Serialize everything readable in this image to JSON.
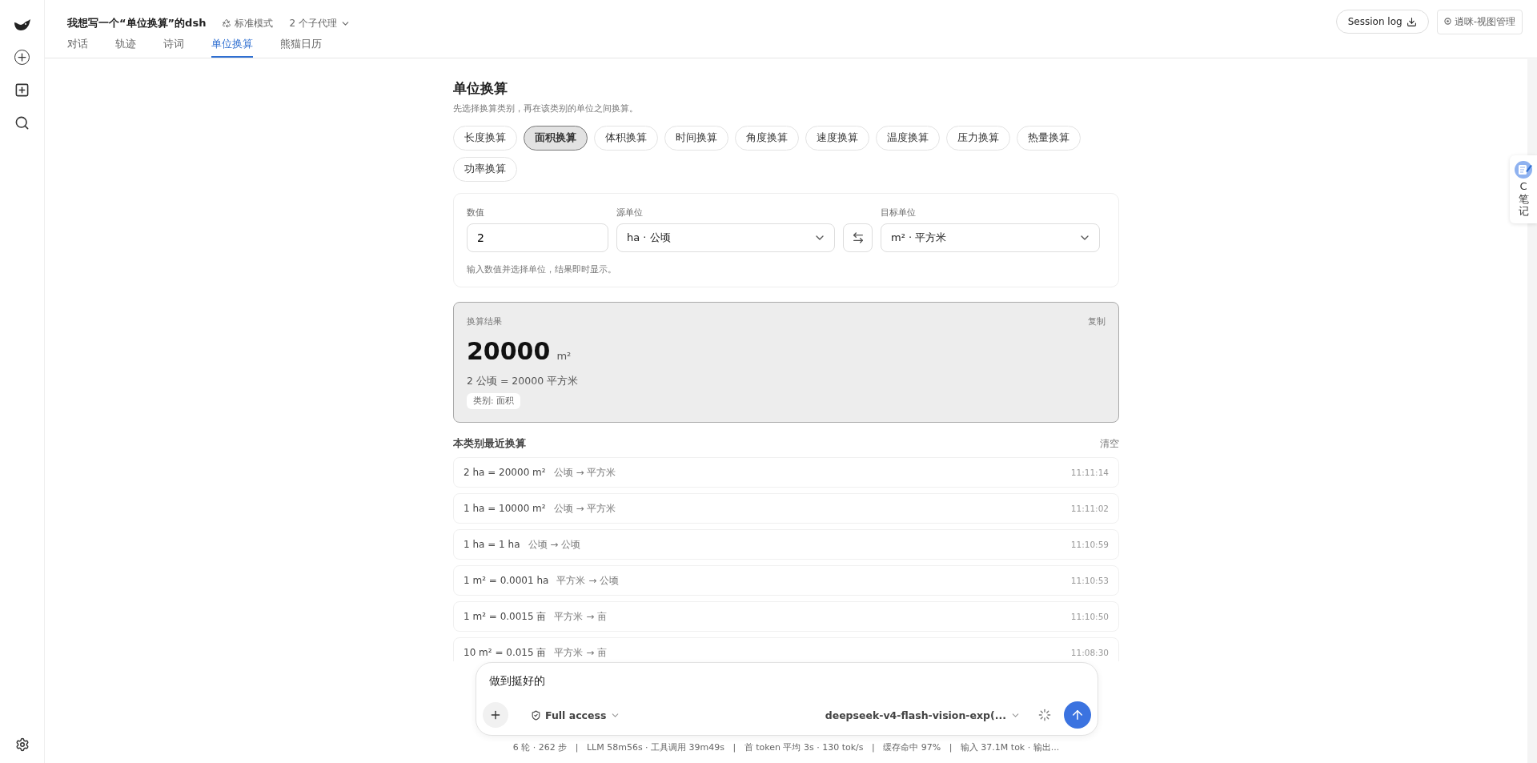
{
  "header": {
    "title": "我想写一个“单位换算”的dsh",
    "mode": "标准模式",
    "agents": "2 个子代理",
    "session_log": "Session log",
    "view_manager": "逍咪-视图管理"
  },
  "tabs": [
    {
      "label": "对话",
      "selected": false
    },
    {
      "label": "轨迹",
      "selected": false
    },
    {
      "label": "诗词",
      "selected": false
    },
    {
      "label": "单位换算",
      "selected": true
    },
    {
      "label": "熊猫日历",
      "selected": false
    }
  ],
  "page": {
    "title": "单位换算",
    "subtitle": "先选择换算类别，再在该类别的单位之间换算。"
  },
  "categories": [
    {
      "label": "长度换算",
      "selected": false
    },
    {
      "label": "面积换算",
      "selected": true
    },
    {
      "label": "体积换算",
      "selected": false
    },
    {
      "label": "时间换算",
      "selected": false
    },
    {
      "label": "角度换算",
      "selected": false
    },
    {
      "label": "速度换算",
      "selected": false
    },
    {
      "label": "温度换算",
      "selected": false
    },
    {
      "label": "压力换算",
      "selected": false
    },
    {
      "label": "热量换算",
      "selected": false
    },
    {
      "label": "功率换算",
      "selected": false
    }
  ],
  "form": {
    "value_label": "数值",
    "value": "2",
    "source_label": "源单位",
    "source": "ha · 公顷",
    "target_label": "目标单位",
    "target": "m² · 平方米",
    "hint": "输入数值并选择单位，结果即时显示。"
  },
  "result": {
    "label": "换算结果",
    "copy": "复制",
    "value": "20000",
    "unit": "m²",
    "formula": "2 公顷 = 20000 平方米",
    "category": "类别: 面积"
  },
  "history": {
    "title": "本类别最近换算",
    "clear": "清空",
    "rows": [
      {
        "expr": "2 ha = 20000 m²",
        "units": "公顷 → 平方米",
        "time": "11:11:14"
      },
      {
        "expr": "1 ha = 10000 m²",
        "units": "公顷 → 平方米",
        "time": "11:11:02"
      },
      {
        "expr": "1 ha = 1 ha",
        "units": "公顷 → 公顷",
        "time": "11:10:59"
      },
      {
        "expr": "1 m² = 0.0001 ha",
        "units": "平方米 → 公顷",
        "time": "11:10:53"
      },
      {
        "expr": "1 m² = 0.0015 亩",
        "units": "平方米 → 亩",
        "time": "11:10:50"
      },
      {
        "expr": "10 m² = 0.015 亩",
        "units": "平方米 → 亩",
        "time": "11:08:30"
      }
    ]
  },
  "composer": {
    "text": "做到挺好的",
    "access": "Full access",
    "model": "deepseek-v4-flash-vision-exp(..."
  },
  "stats": "6 轮 · 262 步   |   LLM 58m56s · 工具调用 39m49s   |   首 token 平均 3s · 130 tok/s   |   缓存命中 97%   |   输入 37.1M tok · 输出...",
  "notes_widget": {
    "letter": "C",
    "label": "笔记"
  }
}
